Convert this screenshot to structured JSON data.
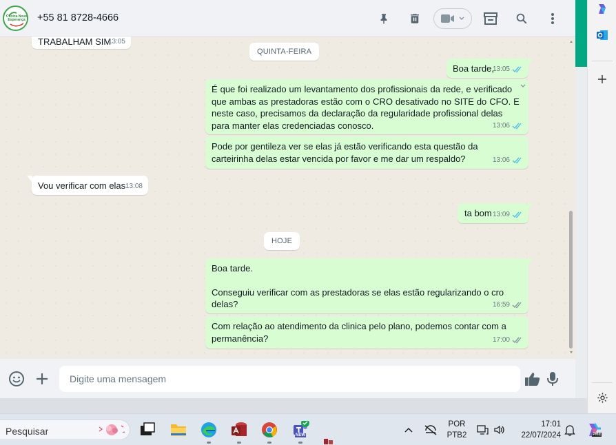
{
  "header": {
    "contact_name": "+55 81 8728-4666",
    "avatar_logo_text": "Clínica Nova Esperança"
  },
  "chat": {
    "messages": [
      {
        "direction": "in",
        "text": "TRABALHAM SIM",
        "time": "13:05"
      },
      {
        "type": "date",
        "text": "QUINTA-FEIRA"
      },
      {
        "direction": "out",
        "text": "Boa tarde,",
        "time": "13:05"
      },
      {
        "direction": "out",
        "text": "É que foi realizado um levantamento dos profissionais da rede, e verificado que ambas as prestadoras estão com o CRO desativado no SITE do CFO. E neste caso, precisamos da declaração da regularidade profissional delas para manter elas credenciadas conosco.",
        "time": "13:06"
      },
      {
        "direction": "out",
        "text": "Pode por gentileza ver se elas já estão verificando esta questão da carteirinha delas estar vencida por favor e me dar um respaldo?",
        "time": "13:06"
      },
      {
        "direction": "in",
        "text": "Vou verificar com elas",
        "time": "13:08"
      },
      {
        "direction": "out",
        "text": "ta bom",
        "time": "13:09"
      },
      {
        "type": "date",
        "text": "HOJE"
      },
      {
        "direction": "out",
        "text_line1": "Boa tarde.",
        "text_line2": "Conseguiu verificar com as prestadoras se elas estão regularizando o cro delas?",
        "time": "16:59"
      },
      {
        "direction": "out",
        "text": "Com relação ao atendimento da clinica pelo plano, podemos contar com a permanência?",
        "time": "17:00"
      }
    ]
  },
  "compose": {
    "placeholder": "Digite uma mensagem"
  },
  "taskbar": {
    "search_placeholder": "Pesquisar",
    "language_line1": "POR",
    "language_line2": "PTB2",
    "clock_time": "17:01",
    "clock_date": "22/07/2024",
    "teams_badge": "NEW",
    "copilot_badge": "PRE"
  },
  "colors": {
    "outgoing_bubble": "#d9fdd3",
    "incoming_bubble": "#ffffff",
    "chat_background": "#efeae2",
    "accent_green": "#00a884",
    "read_ticks": "#53bdeb"
  },
  "icons": [
    "pin-icon",
    "trash-icon",
    "video-call-icon",
    "shop-icon",
    "search-icon",
    "menu-dots-icon",
    "emoji-icon",
    "plus-icon",
    "thumbs-up-icon",
    "microphone-icon",
    "copilot-icon",
    "outlook-icon",
    "add-icon",
    "settings-icon",
    "search-taskbar-icon",
    "wifi-off-icon",
    "volume-icon",
    "notification-bell-icon"
  ]
}
